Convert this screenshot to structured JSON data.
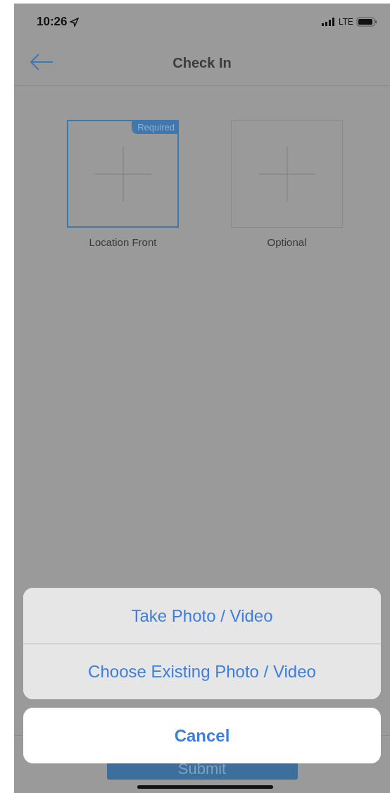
{
  "status_bar": {
    "time": "10:26",
    "network": "LTE"
  },
  "nav": {
    "title": "Check In"
  },
  "slots": [
    {
      "label": "Location Front",
      "badge": "Required",
      "required": true
    },
    {
      "label": "Optional",
      "required": false
    }
  ],
  "footer": {
    "button": "Submit"
  },
  "action_sheet": {
    "options": [
      "Take Photo / Video",
      "Choose Existing Photo / Video"
    ],
    "cancel": "Cancel"
  }
}
